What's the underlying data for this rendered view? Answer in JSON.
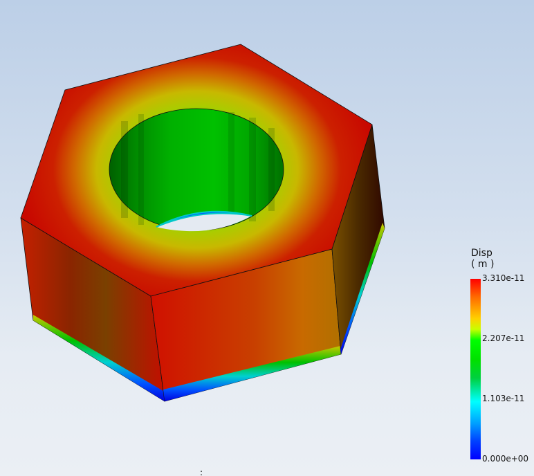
{
  "legend": {
    "title_line1": "Disp",
    "title_line2": "( m )",
    "max_label": "3.310e-11",
    "mid_high_label": "2.207e-11",
    "mid_low_label": "1.103e-11",
    "min_label": "0.000e+00",
    "colors": [
      "#0000ff",
      "#00ffff",
      "#00ff00",
      "#ffff00",
      "#ff0000"
    ]
  },
  "model": {
    "shape": "hex-nut",
    "result": "displacement contour"
  },
  "status_mark": ":"
}
